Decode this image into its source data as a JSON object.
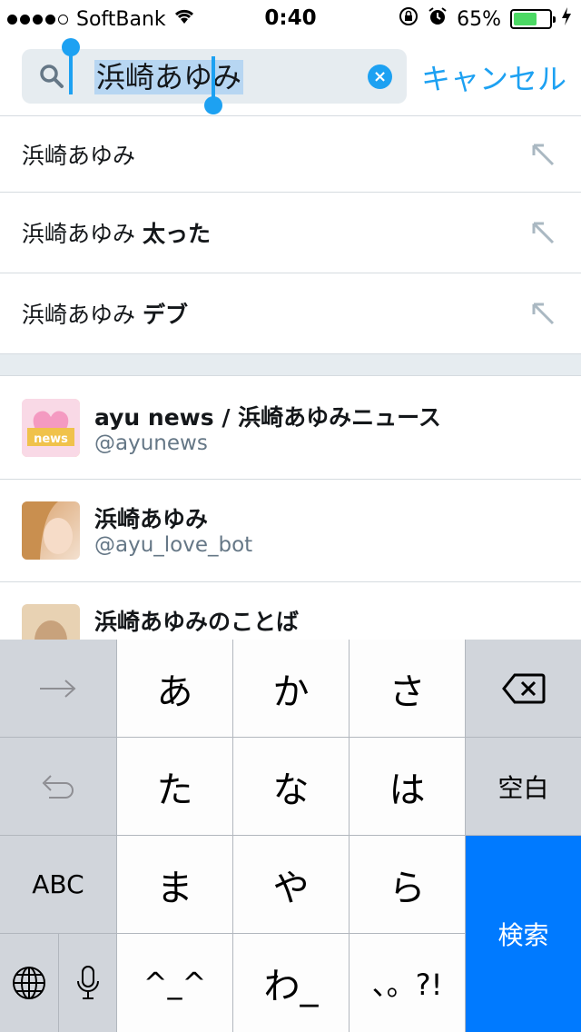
{
  "status_bar": {
    "carrier": "SoftBank",
    "time": "0:40",
    "battery": "65%",
    "battery_level": 0.65
  },
  "search": {
    "query": "浜崎あゆみ",
    "cancel_label": "キャンセル"
  },
  "suggestions": [
    {
      "prefix": "浜崎あゆみ",
      "bold": ""
    },
    {
      "prefix": "浜崎あゆみ ",
      "bold": "太った"
    },
    {
      "prefix": "浜崎あゆみ ",
      "bold": "デブ"
    }
  ],
  "users": [
    {
      "name": "ayu news / 浜崎あゆみニュース",
      "handle": "@ayunews"
    },
    {
      "name": "浜崎あゆみ",
      "handle": "@ayu_love_bot"
    },
    {
      "name": "浜崎あゆみのことば",
      "handle": ""
    }
  ],
  "keyboard": {
    "keys": {
      "a": "あ",
      "ka": "か",
      "sa": "さ",
      "ta": "た",
      "na": "な",
      "ha": "は",
      "ma": "ま",
      "ya": "や",
      "ra": "ら",
      "kaomoji": "^_^",
      "wa": "わ_",
      "punct": "、。?!"
    },
    "space_label": "空白",
    "abc_label": "ABC",
    "search_label": "検索"
  },
  "colors": {
    "accent": "#1da1f2",
    "keyboard_blue": "#007aff"
  }
}
